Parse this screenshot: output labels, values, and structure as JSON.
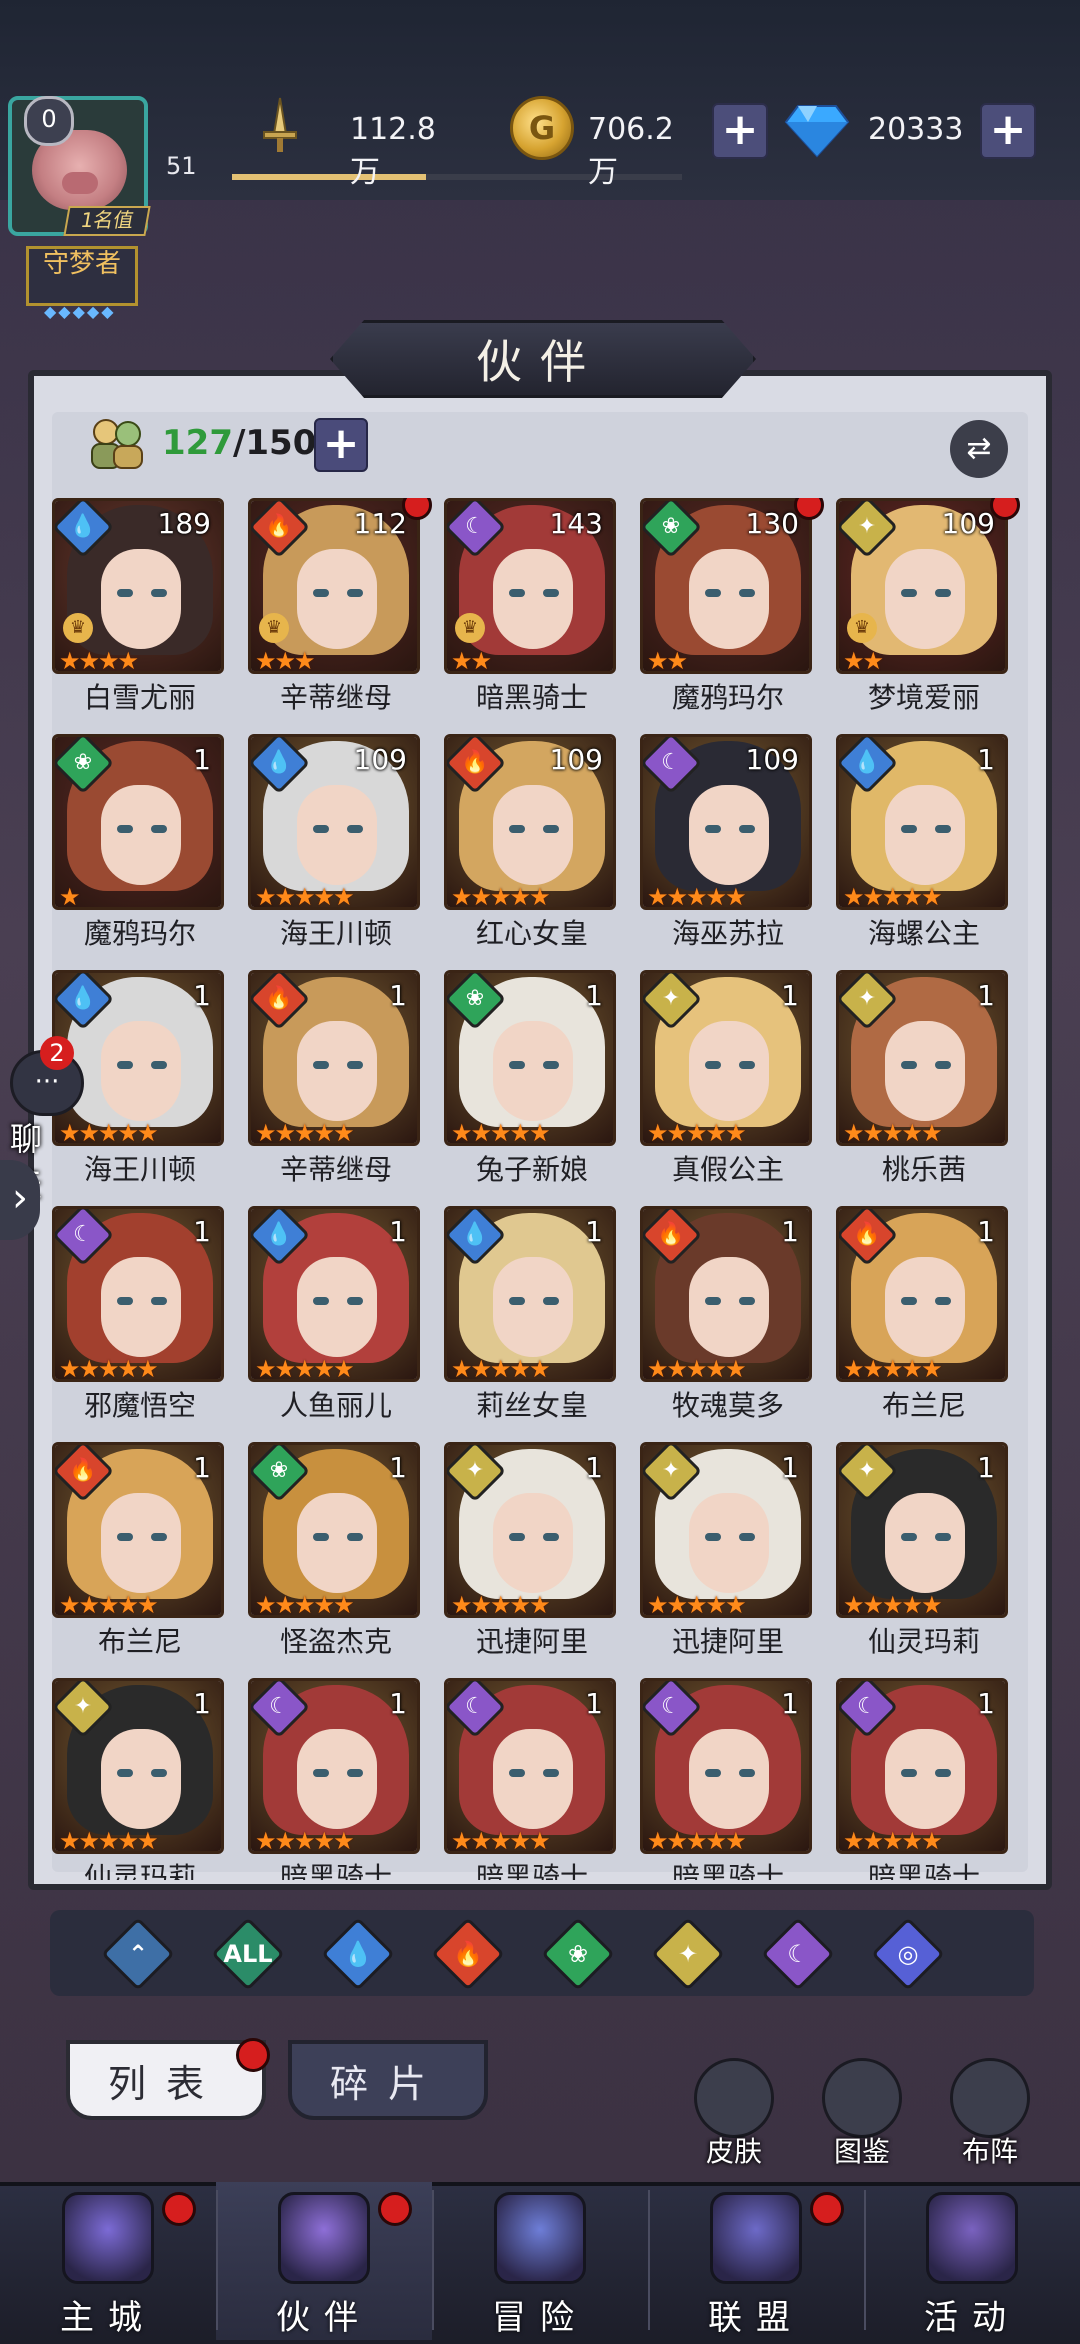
{
  "player": {
    "vip_level": "0",
    "avatar_tag": "1名值",
    "level": "51",
    "exp_fraction": 0.43,
    "title_badge": "守梦者"
  },
  "resources": {
    "power": "112.8万",
    "gold": "706.2万",
    "gems": "20333"
  },
  "page": {
    "title": "伙伴"
  },
  "roster": {
    "current": "127",
    "max": "/150"
  },
  "element_colors": {
    "water": "#3f7fd6",
    "fire": "#d8452c",
    "wind": "#2fa45a",
    "light": "#c8b24a",
    "dark": "#8a56c8"
  },
  "cards": [
    {
      "name": "白雪尤丽",
      "level": "189",
      "element": "water",
      "stars": 4,
      "crown": true,
      "dot": false,
      "hair": "#3a2a28",
      "bg": "#6b3a30"
    },
    {
      "name": "辛蒂继母",
      "level": "112",
      "element": "fire",
      "stars": 3,
      "crown": true,
      "dot": true,
      "hair": "#c89a5a",
      "bg": "#5a2a26"
    },
    {
      "name": "暗黑骑士",
      "level": "143",
      "element": "dark",
      "stars": 2,
      "crown": true,
      "dot": false,
      "hair": "#a23a38",
      "bg": "#5a2a26"
    },
    {
      "name": "魔鸦玛尔",
      "level": "130",
      "element": "wind",
      "stars": 2,
      "crown": false,
      "dot": true,
      "hair": "#9a4a32",
      "bg": "#5a2a26"
    },
    {
      "name": "梦境爱丽",
      "level": "109",
      "element": "light",
      "stars": 2,
      "crown": true,
      "dot": true,
      "hair": "#e2b872",
      "bg": "#6a2a28"
    },
    {
      "name": "魔鸦玛尔",
      "level": "1",
      "element": "wind",
      "stars": 1,
      "crown": false,
      "dot": false,
      "hair": "#9a4a32",
      "bg": "#5a2a26"
    },
    {
      "name": "海王川顿",
      "level": "109",
      "element": "water",
      "stars": 5,
      "crown": false,
      "dot": false,
      "hair": "#d8d8d8",
      "bg": "#7a6034"
    },
    {
      "name": "红心女皇",
      "level": "109",
      "element": "fire",
      "stars": 5,
      "crown": false,
      "dot": false,
      "hair": "#d3a660",
      "bg": "#7a6034"
    },
    {
      "name": "海巫苏拉",
      "level": "109",
      "element": "dark",
      "stars": 5,
      "crown": false,
      "dot": false,
      "hair": "#2a2a34",
      "bg": "#7a6034"
    },
    {
      "name": "海螺公主",
      "level": "1",
      "element": "water",
      "stars": 5,
      "crown": false,
      "dot": false,
      "hair": "#e0b868",
      "bg": "#7a6034"
    },
    {
      "name": "海王川顿",
      "level": "1",
      "element": "water",
      "stars": 5,
      "crown": false,
      "dot": false,
      "hair": "#d8d8d8",
      "bg": "#7a6034"
    },
    {
      "name": "辛蒂继母",
      "level": "1",
      "element": "fire",
      "stars": 5,
      "crown": false,
      "dot": false,
      "hair": "#c89a5a",
      "bg": "#7a6034"
    },
    {
      "name": "兔子新娘",
      "level": "1",
      "element": "wind",
      "stars": 5,
      "crown": false,
      "dot": false,
      "hair": "#e8e4dc",
      "bg": "#7a6034"
    },
    {
      "name": "真假公主",
      "level": "1",
      "element": "light",
      "stars": 5,
      "crown": false,
      "dot": false,
      "hair": "#e6c27c",
      "bg": "#7a6034"
    },
    {
      "name": "桃乐茜",
      "level": "1",
      "element": "light",
      "stars": 5,
      "crown": false,
      "dot": false,
      "hair": "#b06a44",
      "bg": "#7a6034"
    },
    {
      "name": "邪魔悟空",
      "level": "1",
      "element": "dark",
      "stars": 5,
      "crown": false,
      "dot": false,
      "hair": "#a2402e",
      "bg": "#7a6034"
    },
    {
      "name": "人鱼丽儿",
      "level": "1",
      "element": "water",
      "stars": 5,
      "crown": false,
      "dot": false,
      "hair": "#b2403c",
      "bg": "#7a6034"
    },
    {
      "name": "莉丝女皇",
      "level": "1",
      "element": "water",
      "stars": 5,
      "crown": false,
      "dot": false,
      "hair": "#e0c890",
      "bg": "#7a6034"
    },
    {
      "name": "牧魂莫多",
      "level": "1",
      "element": "fire",
      "stars": 5,
      "crown": false,
      "dot": false,
      "hair": "#6a3a2a",
      "bg": "#7a6034"
    },
    {
      "name": "布兰尼",
      "level": "1",
      "element": "fire",
      "stars": 5,
      "crown": false,
      "dot": false,
      "hair": "#d8a458",
      "bg": "#7a6034"
    },
    {
      "name": "布兰尼",
      "level": "1",
      "element": "fire",
      "stars": 5,
      "crown": false,
      "dot": false,
      "hair": "#d8a458",
      "bg": "#7a6034"
    },
    {
      "name": "怪盗杰克",
      "level": "1",
      "element": "wind",
      "stars": 5,
      "crown": false,
      "dot": false,
      "hair": "#c8903e",
      "bg": "#7a6034"
    },
    {
      "name": "迅捷阿里",
      "level": "1",
      "element": "light",
      "stars": 5,
      "crown": false,
      "dot": false,
      "hair": "#e8e4dc",
      "bg": "#7a6034"
    },
    {
      "name": "迅捷阿里",
      "level": "1",
      "element": "light",
      "stars": 5,
      "crown": false,
      "dot": false,
      "hair": "#e8e4dc",
      "bg": "#7a6034"
    },
    {
      "name": "仙灵玛莉",
      "level": "1",
      "element": "light",
      "stars": 5,
      "crown": false,
      "dot": false,
      "hair": "#2a2a2a",
      "bg": "#7a6034"
    },
    {
      "name": "仙灵玛莉",
      "level": "1",
      "element": "light",
      "stars": 5,
      "crown": false,
      "dot": false,
      "hair": "#2a2a2a",
      "bg": "#7a6034"
    },
    {
      "name": "暗黑骑士",
      "level": "1",
      "element": "dark",
      "stars": 5,
      "crown": false,
      "dot": false,
      "hair": "#a23a38",
      "bg": "#7a6034"
    },
    {
      "name": "暗黑骑士",
      "level": "1",
      "element": "dark",
      "stars": 5,
      "crown": false,
      "dot": false,
      "hair": "#a23a38",
      "bg": "#7a6034"
    },
    {
      "name": "暗黑骑士",
      "level": "1",
      "element": "dark",
      "stars": 5,
      "crown": false,
      "dot": false,
      "hair": "#a23a38",
      "bg": "#7a6034"
    },
    {
      "name": "暗黑骑士",
      "level": "1",
      "element": "dark",
      "stars": 5,
      "crown": false,
      "dot": false,
      "hair": "#a23a38",
      "bg": "#7a6034"
    }
  ],
  "filters": [
    {
      "key": "rarity",
      "label": "",
      "color": "#3e6fa6"
    },
    {
      "key": "all",
      "label": "ALL",
      "color": "#2b8c68"
    },
    {
      "key": "water",
      "label": "",
      "color": "#3f7fd6"
    },
    {
      "key": "fire",
      "label": "",
      "color": "#d8452c"
    },
    {
      "key": "wind",
      "label": "",
      "color": "#2fa45a"
    },
    {
      "key": "light",
      "label": "",
      "color": "#c8b24a"
    },
    {
      "key": "dark",
      "label": "",
      "color": "#8a56c8"
    },
    {
      "key": "cosmic",
      "label": "",
      "color": "#5660d6"
    }
  ],
  "tabs": {
    "list": "列表",
    "fragments": "碎片"
  },
  "side_buttons": {
    "skin": "皮肤",
    "codex": "图鉴",
    "formation": "布阵"
  },
  "chat": {
    "badge": "2",
    "label": "聊天"
  },
  "bottom_nav": [
    {
      "label": "主城",
      "dot": true,
      "color": "#7c6bd6"
    },
    {
      "label": "伙伴",
      "dot": true,
      "color": "#8e6fd8"
    },
    {
      "label": "冒险",
      "dot": false,
      "color": "#6e7ed8"
    },
    {
      "label": "联盟",
      "dot": true,
      "color": "#6d6ac8"
    },
    {
      "label": "活动",
      "dot": false,
      "color": "#7a62c0"
    }
  ]
}
